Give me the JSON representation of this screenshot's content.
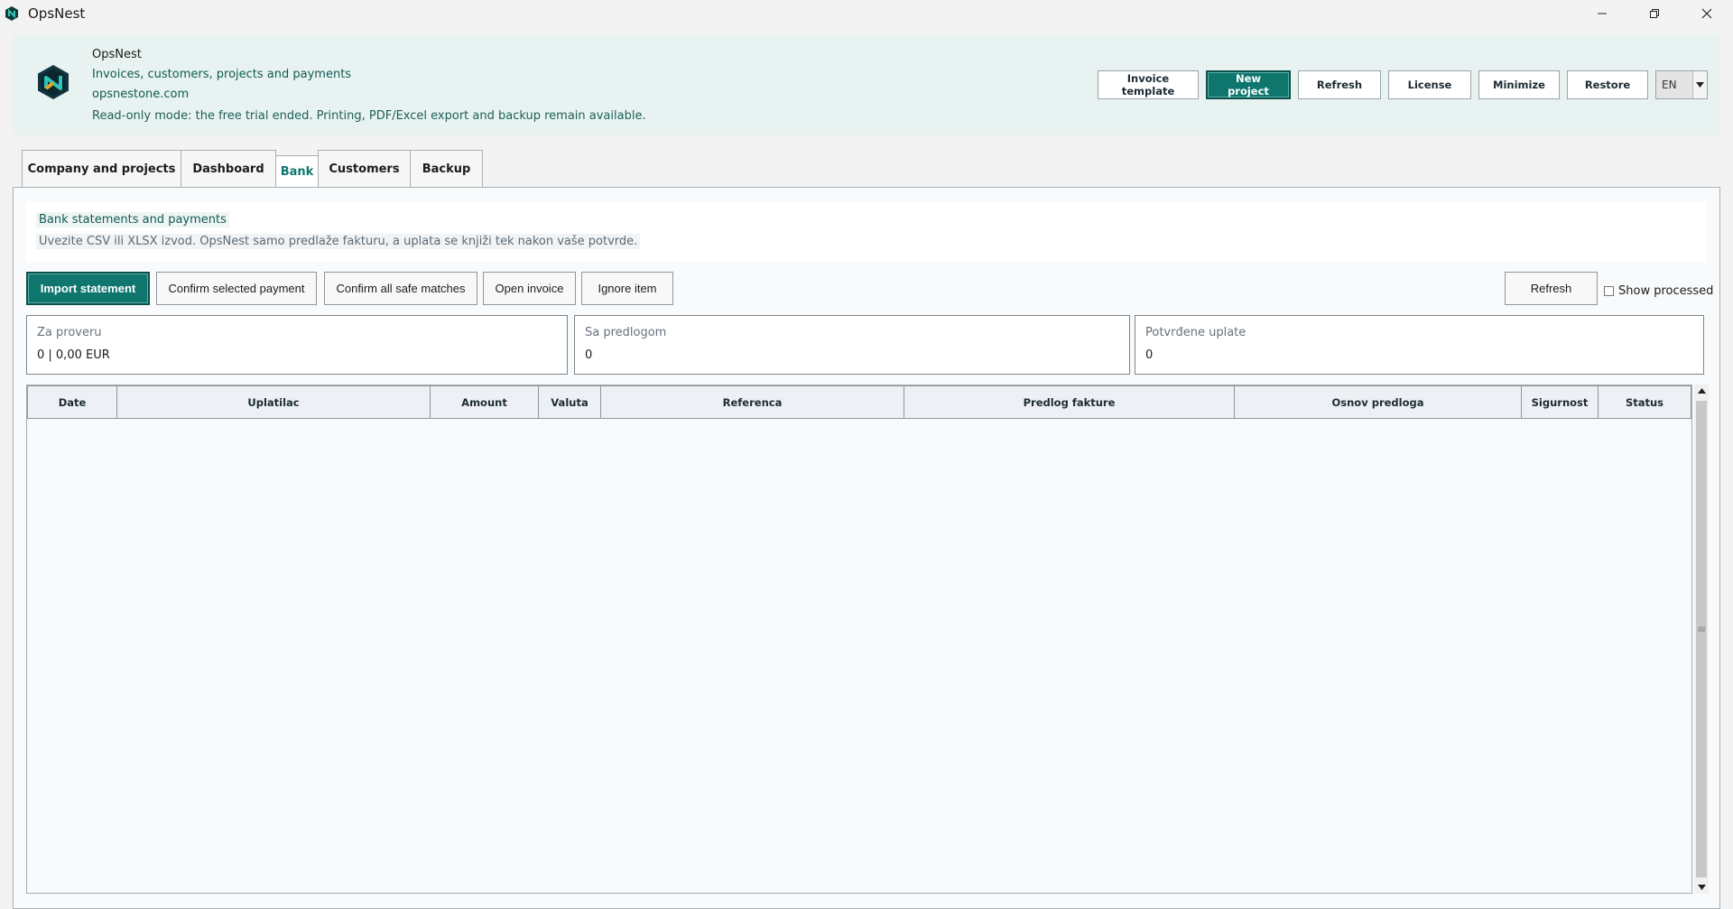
{
  "window": {
    "title": "OpsNest",
    "controls": [
      "minimize-icon",
      "restore-icon",
      "close-icon"
    ]
  },
  "header": {
    "app_name": "OpsNest",
    "tagline": "Invoices, customers, projects and payments",
    "website": "opsnestone.com",
    "notice": "Read-only mode: the free trial ended. Printing, PDF/Excel export and backup remain available.",
    "buttons": {
      "invoice_template": "Invoice template",
      "new_project": "New project",
      "refresh": "Refresh",
      "license": "License",
      "minimize": "Minimize",
      "restore": "Restore"
    },
    "language": "EN"
  },
  "tabs": {
    "company": "Company and projects",
    "dashboard": "Dashboard",
    "bank": "Bank",
    "customers": "Customers",
    "backup": "Backup"
  },
  "bank": {
    "title": "Bank statements and payments",
    "subtitle": "Uvezite CSV ili XLSX izvod. OpsNest samo predlaže fakturu, a uplata se knjiži tek nakon vaše potvrde.",
    "actions": {
      "import": "Import statement",
      "confirm_selected": "Confirm selected payment",
      "confirm_all": "Confirm all safe matches",
      "open_invoice": "Open invoice",
      "ignore": "Ignore item",
      "refresh": "Refresh",
      "show_processed": "Show processed"
    },
    "stats": {
      "to_review_label": "Za proveru",
      "to_review_value": "0 | 0,00 EUR",
      "suggested_label": "Sa predlogom",
      "suggested_value": "0",
      "confirmed_label": "Potvrđene uplate",
      "confirmed_value": "0"
    },
    "table": {
      "columns": [
        "Date",
        "Uplatilac",
        "Amount",
        "Valuta",
        "Referenca",
        "Predlog fakture",
        "Osnov predloga",
        "Sigurnost",
        "Status"
      ],
      "rows": []
    }
  },
  "colors": {
    "accent": "#0f766e",
    "header_bg": "#e8f3f1"
  }
}
